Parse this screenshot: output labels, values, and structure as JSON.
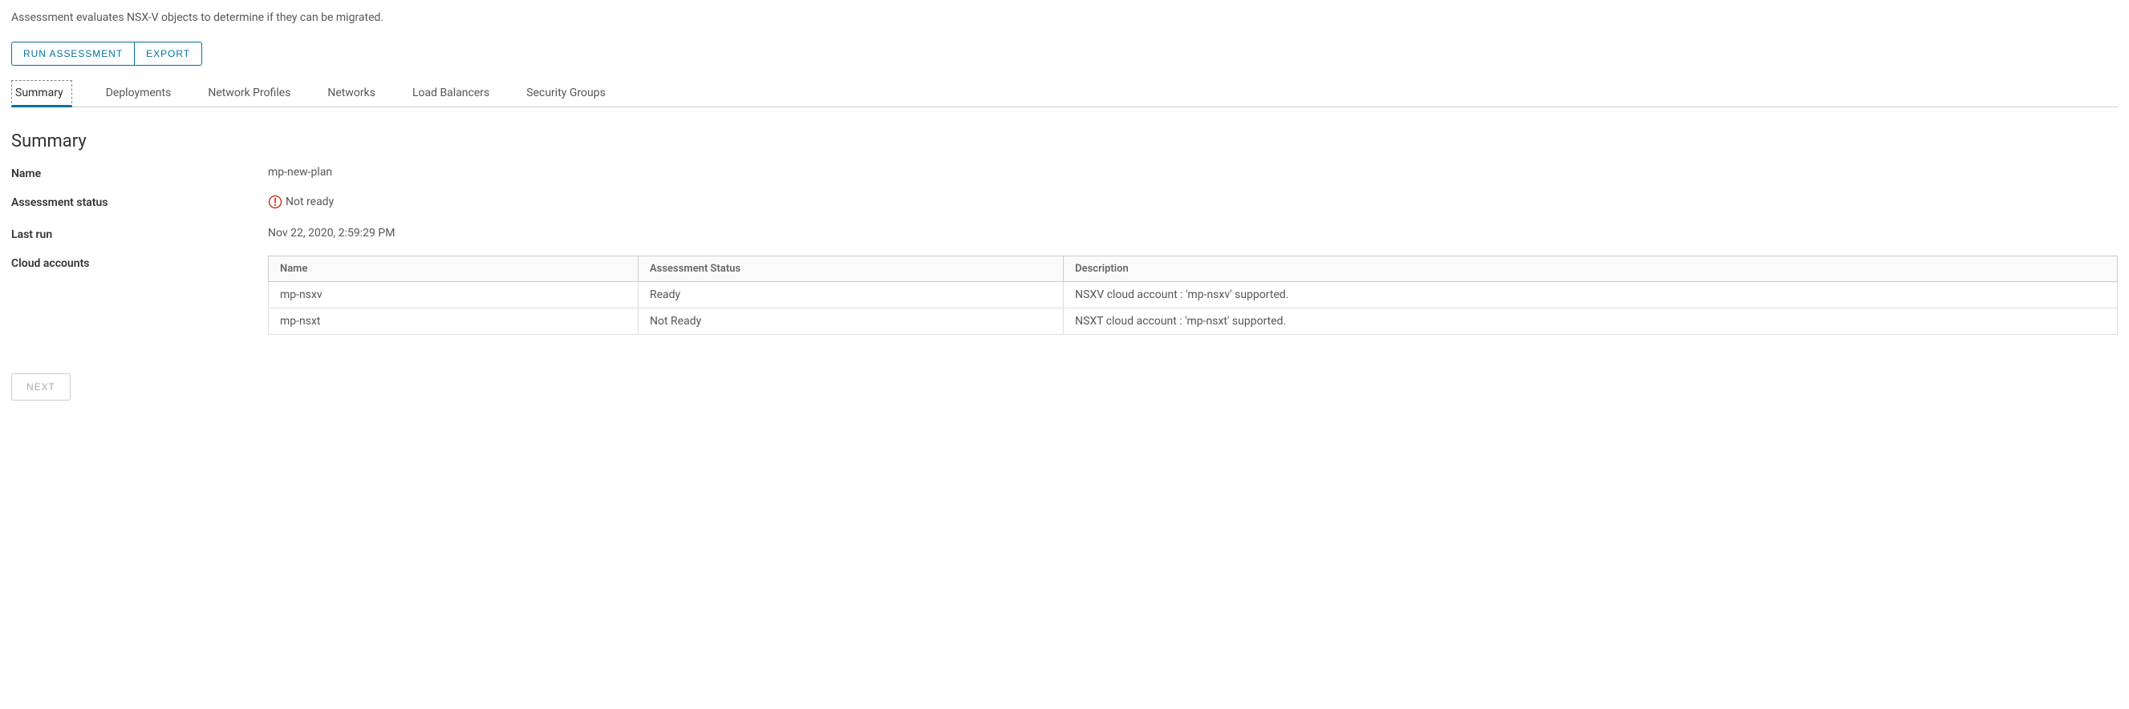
{
  "description": "Assessment evaluates NSX-V objects to determine if they can be migrated.",
  "buttons": {
    "run_assessment": "RUN ASSESSMENT",
    "export": "EXPORT",
    "next": "NEXT"
  },
  "tabs": [
    {
      "label": "Summary"
    },
    {
      "label": "Deployments"
    },
    {
      "label": "Network Profiles"
    },
    {
      "label": "Networks"
    },
    {
      "label": "Load Balancers"
    },
    {
      "label": "Security Groups"
    }
  ],
  "section_title": "Summary",
  "fields": {
    "name_label": "Name",
    "name_value": "mp-new-plan",
    "status_label": "Assessment status",
    "status_value": "Not ready",
    "lastrun_label": "Last run",
    "lastrun_value": "Nov 22, 2020, 2:59:29 PM",
    "cloud_label": "Cloud accounts"
  },
  "cloud_table": {
    "headers": {
      "name": "Name",
      "status": "Assessment Status",
      "description": "Description"
    },
    "rows": [
      {
        "name": "mp-nsxv",
        "status": "Ready",
        "description": "NSXV cloud account : 'mp-nsxv' supported."
      },
      {
        "name": "mp-nsxt",
        "status": "Not Ready",
        "description": "NSXT cloud account : 'mp-nsxt' supported."
      }
    ]
  }
}
